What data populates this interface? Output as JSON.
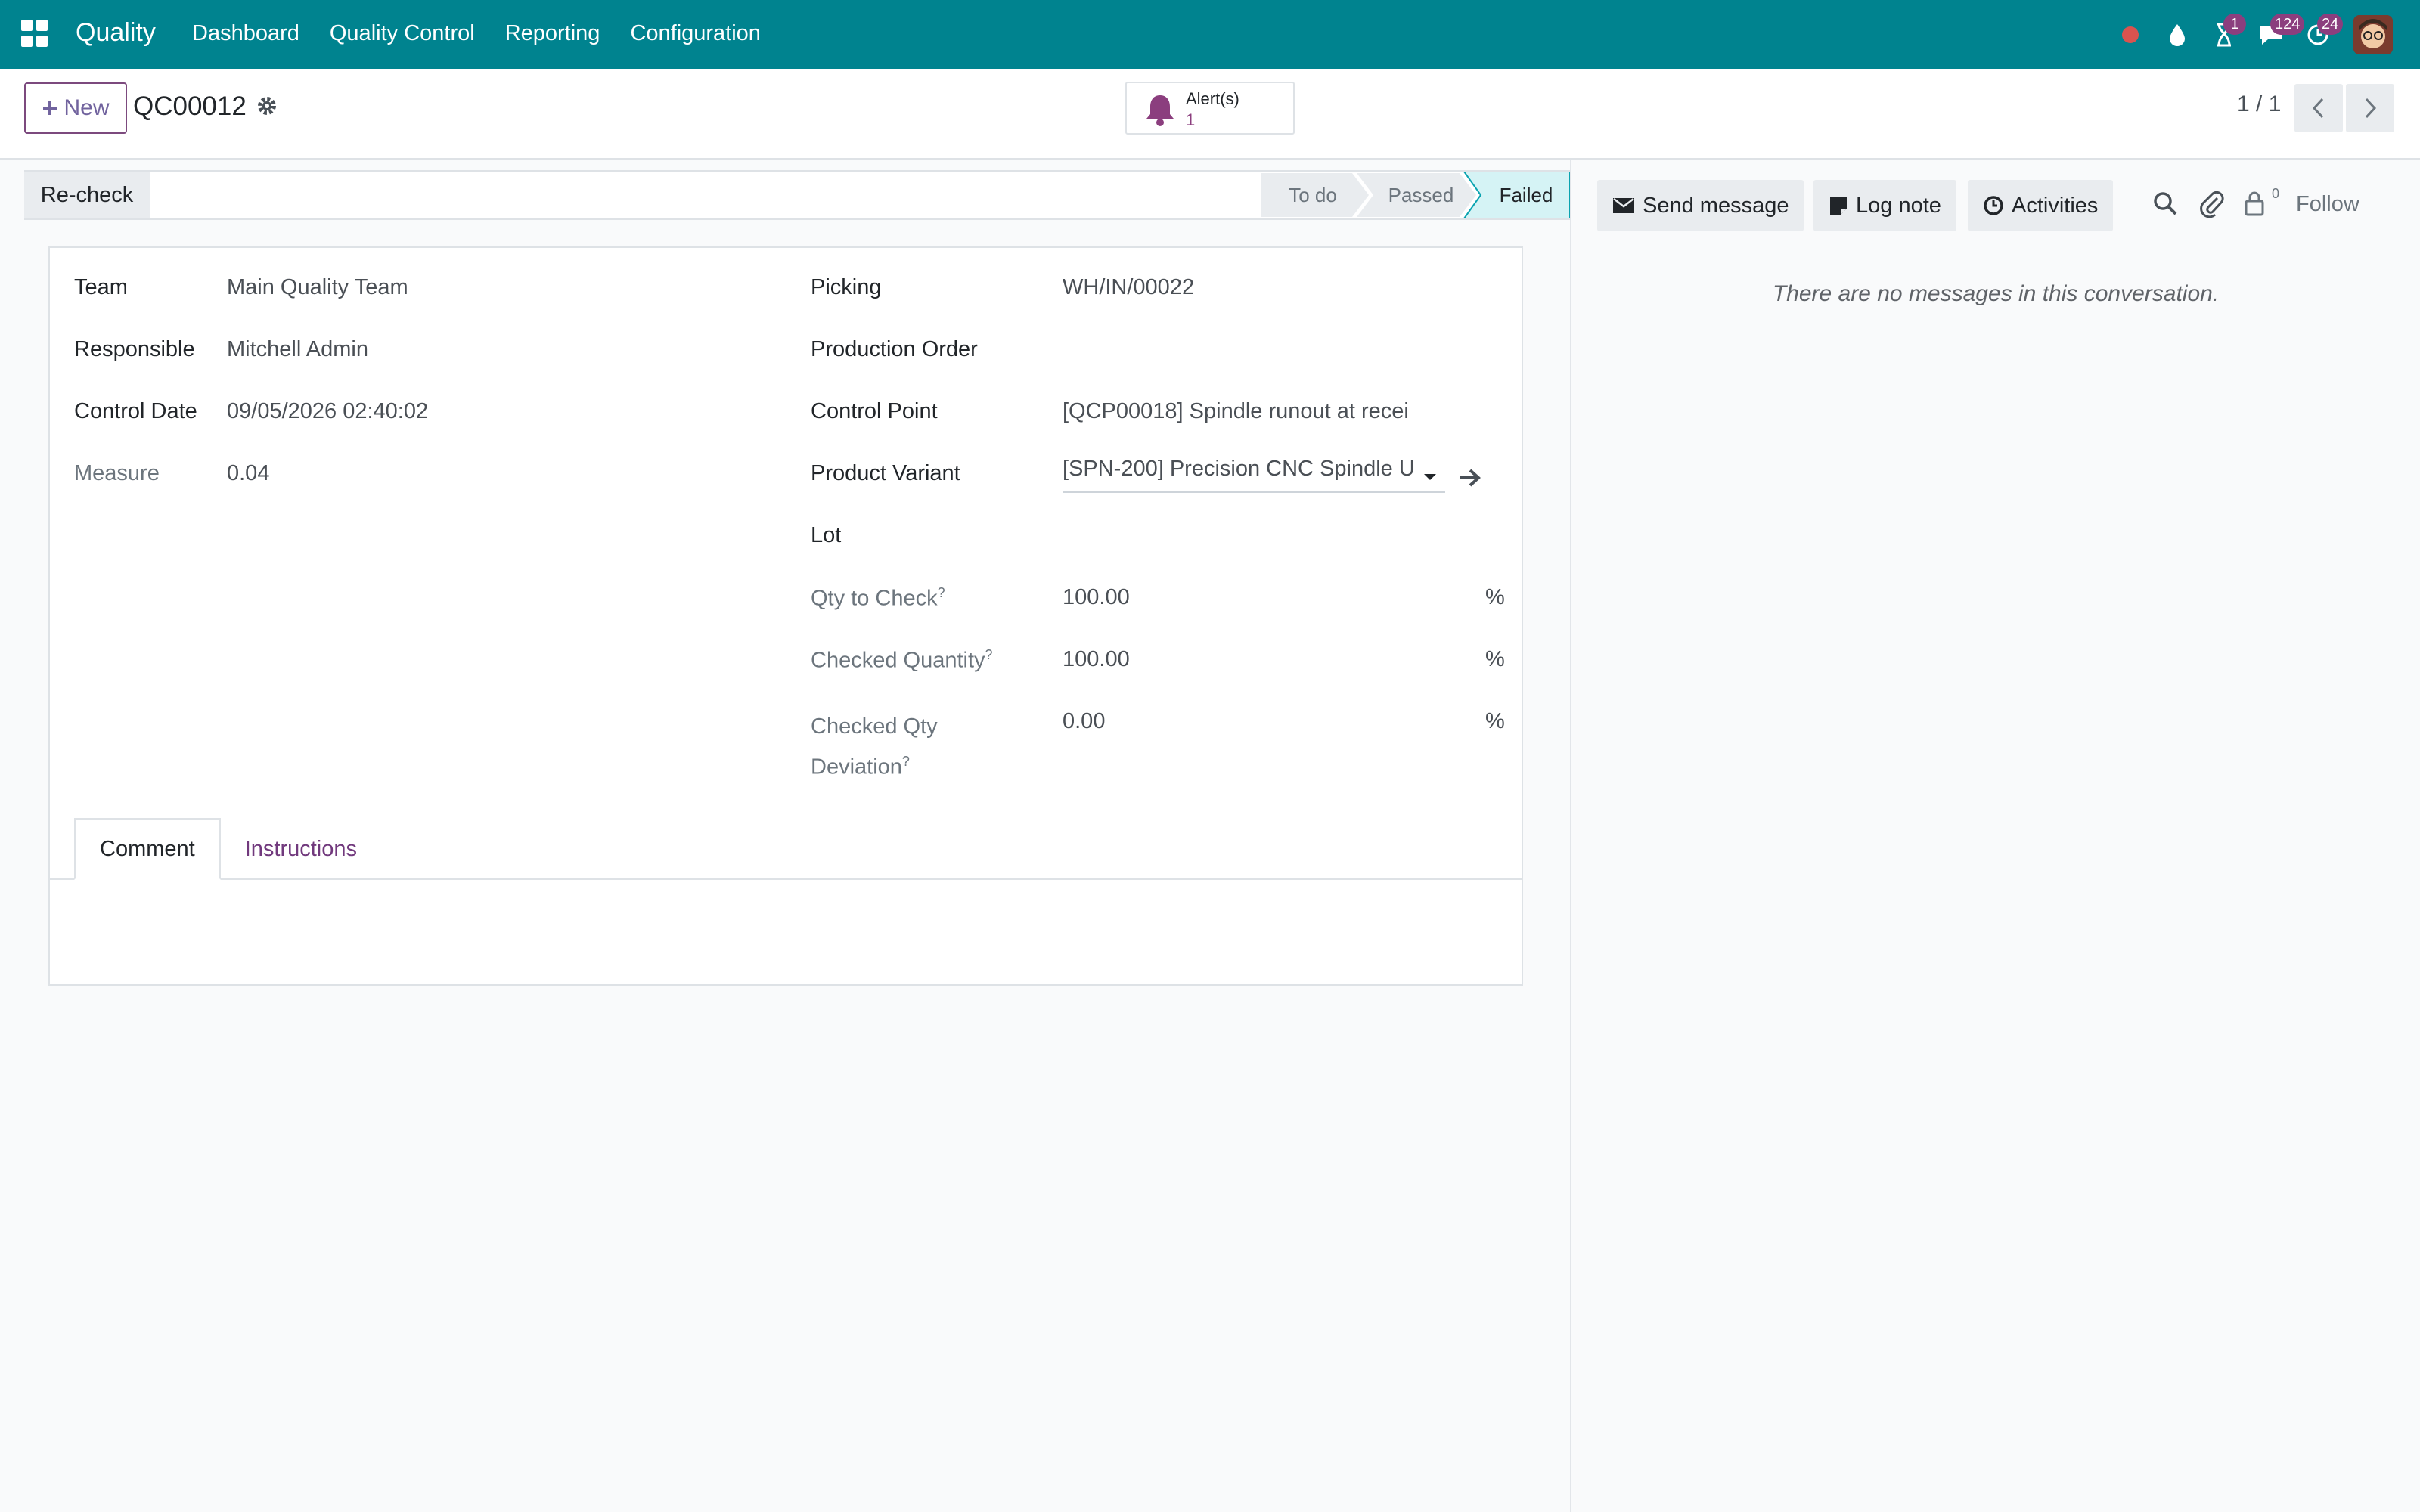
{
  "topbar": {
    "app_name": "Quality",
    "nav": [
      "Dashboard",
      "Quality Control",
      "Reporting",
      "Configuration"
    ],
    "activity_badge": "1",
    "messages_badge": "124",
    "updates_badge": "24",
    "icons": [
      "apps-grid-icon",
      "record-dot-icon",
      "droplet-icon",
      "hourglass-icon",
      "chat-icon",
      "clock-icon",
      "user-avatar"
    ],
    "accent": "#00838f"
  },
  "control_panel": {
    "new_label": "New",
    "record_name": "QC00012",
    "alerts_label": "Alert(s)",
    "alerts_count": "1",
    "pager": "1 / 1"
  },
  "statusbar": {
    "recheck_label": "Re-check",
    "stages": [
      "To do",
      "Passed",
      "Failed"
    ],
    "current_stage": "Failed"
  },
  "form": {
    "left": [
      {
        "label": "Team",
        "value": "Main Quality Team"
      },
      {
        "label": "Responsible",
        "value": "Mitchell Admin"
      },
      {
        "label": "Control Date",
        "value": "09/05/2026 02:40:02"
      },
      {
        "label": "Measure",
        "value": "0.04"
      }
    ],
    "right": {
      "picking": {
        "label": "Picking",
        "value": "WH/IN/00022"
      },
      "production_order": {
        "label": "Production Order",
        "value": ""
      },
      "control_point": {
        "label": "Control Point",
        "value": "[QCP00018] Spindle runout at recei"
      },
      "product_variant": {
        "label": "Product Variant",
        "value": "[SPN-200] Precision CNC Spindle U"
      },
      "lot": {
        "label": "Lot",
        "value": ""
      },
      "qty_to_check": {
        "label": "Qty to Check",
        "help": "?",
        "value": "100.00",
        "unit": "%"
      },
      "checked_quantity": {
        "label": "Checked Quantity",
        "help": "?",
        "value": "100.00",
        "unit": "%"
      },
      "checked_qty_deviation": {
        "label_line1": "Checked Qty",
        "label_line2": "Deviation",
        "help": "?",
        "value": "0.00",
        "unit": "%"
      }
    },
    "tabs": [
      "Comment",
      "Instructions"
    ]
  },
  "chatter": {
    "send_message": "Send message",
    "log_note": "Log note",
    "activities": "Activities",
    "follower_count": "0",
    "follow": "Follow",
    "empty_text": "There are no messages in this conversation."
  }
}
